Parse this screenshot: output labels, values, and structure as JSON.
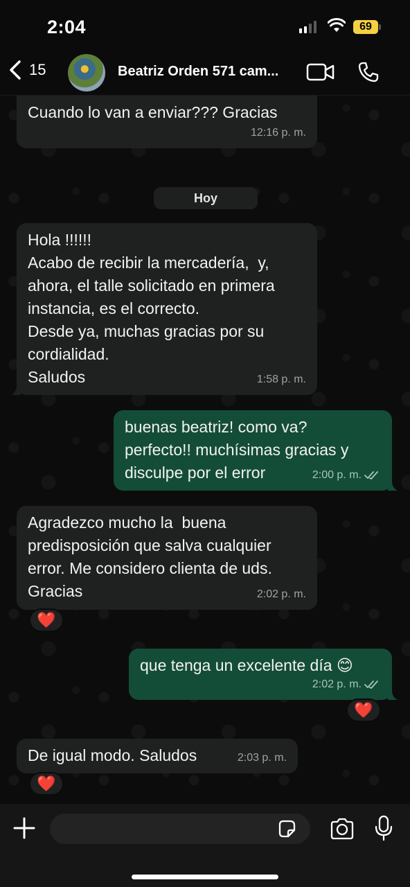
{
  "status_bar": {
    "time": "2:04",
    "battery": "69"
  },
  "header": {
    "back_count": "15",
    "contact_name": "Beatriz Orden 571 cam..."
  },
  "date_separator": "Hoy",
  "messages": [
    {
      "direction": "in",
      "text": "Cuando lo van a enviar??? Gracias",
      "time": "12:16 p. m."
    },
    {
      "direction": "in",
      "text": "Hola !!!!!!\nAcabo de recibir la mercadería,  y,\nahora, el talle solicitado en primera\ninstancia, es el correcto.\nDesde ya, muchas gracias por su\ncordialidad.\nSaludos",
      "time": "1:58 p. m."
    },
    {
      "direction": "out",
      "text": "buenas beatriz! como va?\nperfecto!! muchísimas gracias y\ndisculpe por el error",
      "time": "2:00 p. m.",
      "read": true
    },
    {
      "direction": "in",
      "text": "Agradezco mucho la  buena\npredisposición que salva cualquier\nerror. Me considero clienta de uds.\nGracias",
      "time": "2:02 p. m.",
      "reaction": "❤️"
    },
    {
      "direction": "out",
      "text": "que tenga un excelente día 😊",
      "time": "2:02 p. m.",
      "read": true,
      "reaction": "❤️"
    },
    {
      "direction": "in",
      "text": "De igual modo. Saludos",
      "time": "2:03 p. m.",
      "reaction": "❤️"
    }
  ],
  "input": {
    "placeholder": ""
  },
  "colors": {
    "incoming_bubble": "#1f2120",
    "outgoing_bubble": "#144d37",
    "read_tick": "#a8c5b8"
  },
  "icons": [
    "back-chevron-icon",
    "video-call-icon",
    "phone-icon",
    "plus-icon",
    "sticker-icon",
    "camera-icon",
    "microphone-icon"
  ]
}
